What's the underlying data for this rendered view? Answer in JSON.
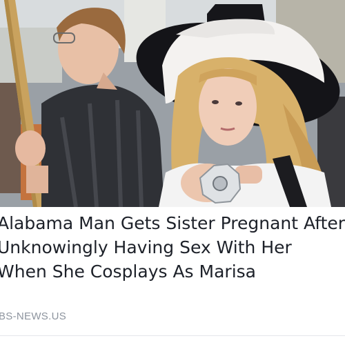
{
  "article": {
    "headline_lines": [
      "Alabama Man Gets Sister Pregnant After",
      "Unknowingly Having Sex With Her",
      "When She Cosplays As Marisa"
    ],
    "source": "BS-NEWS.US"
  },
  "colors": {
    "headline": "#1d2129",
    "source": "#8d949e",
    "background": "#ffffff"
  }
}
